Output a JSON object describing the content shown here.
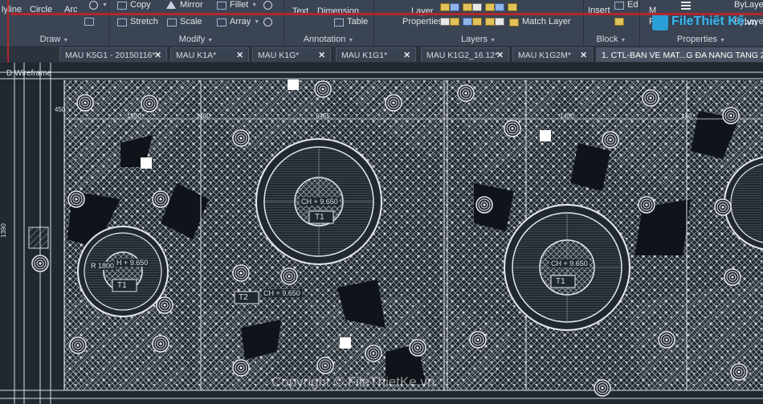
{
  "ribbon": {
    "draw": {
      "title": "Draw",
      "polyline": "lyline",
      "circle": "Circle",
      "arc": "Arc"
    },
    "modify": {
      "title": "Modify",
      "copy": "Copy",
      "mirror": "Mirror",
      "fillet": "Fillet",
      "stretch": "Stretch",
      "scale": "Scale",
      "array": "Array"
    },
    "annotation": {
      "title": "Annotation",
      "text": "Text",
      "dimension": "Dimension",
      "table": "Table"
    },
    "layers": {
      "title": "Layers",
      "layer": "Layer",
      "properties": "Properties",
      "match_layer": "Match Layer"
    },
    "block": {
      "title": "Block",
      "insert": "Insert",
      "edit": "Ed",
      "match": "M",
      "properties": "Pro"
    },
    "properties": {
      "title": "Properties",
      "bylayer_1": "ByLaye",
      "bylayer_2": "ByLaye"
    }
  },
  "logo": {
    "brand": "File",
    "rest": "Thiết Kế",
    "tld": ".vn"
  },
  "tabs": [
    {
      "label": "MAU K5G1 - 20150116*",
      "active": false
    },
    {
      "label": "MAU K1A*",
      "active": false
    },
    {
      "label": "MAU K1G*",
      "active": false
    },
    {
      "label": "MAU K1G1*",
      "active": false
    },
    {
      "label": "MAU K1G2_16.12*",
      "active": false
    },
    {
      "label": "MAU K1G2M*",
      "active": false
    },
    {
      "label": "1. CTL-BAN VE MAT...G ĐA NANG TANG 2*",
      "active": true
    }
  ],
  "tab_close": "✕",
  "viewport": {
    "visual_style": "D Wireframe",
    "scale_left": "1390",
    "dim_labels": [
      "450",
      "1590",
      "1400",
      "9455",
      "1450",
      "140"
    ],
    "callouts": {
      "c1_level": "CH + 9.650",
      "c1_tag": "T1",
      "c2_level": "H + 9.650",
      "c2_radius": "R 1800",
      "c2_tag": "T1",
      "c3_level": "CH + 9.650",
      "c3_tag": "T1",
      "c4_level": "CH + 9.650",
      "c4_tag": "T2"
    }
  },
  "watermark": "Copyright © FileThietKe.vn",
  "colors": {
    "ribbon_bg": "#3b4453",
    "canvas_bg": "#212830",
    "hatch_line": "#c9cfd6",
    "accent_red": "#b3262d",
    "logo_blue": "#41b6ea"
  }
}
